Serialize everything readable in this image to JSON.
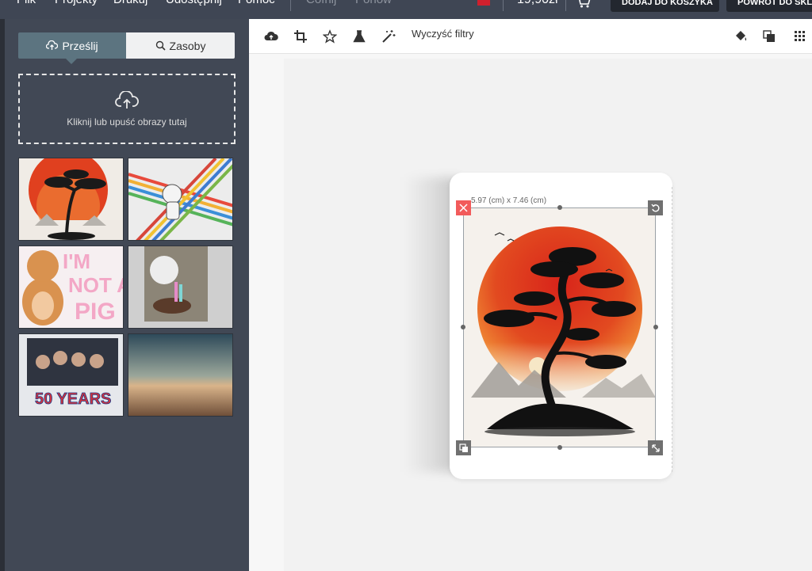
{
  "menu": {
    "items": [
      "Plik",
      "Projekty",
      "Drukuj",
      "Udostępnij",
      "Pomoc"
    ],
    "undo": "Cofnij",
    "redo": "Ponów"
  },
  "header": {
    "price": "19,90zł",
    "add_to_cart": "DODAJ DO KOSZYKA",
    "back_to_shop": "POWRÓT DO SKL"
  },
  "sidebar": {
    "tab_upload": "Prześlij",
    "tab_resources": "Zasoby",
    "dropzone_text": "Kliknij lub upuść obrazy tutaj",
    "thumbnails": [
      {
        "name": "thumb-bonsai-sunset"
      },
      {
        "name": "thumb-astronaut-stripes"
      },
      {
        "name": "thumb-im-not-a-pig",
        "text": "I'M NOT A PIG"
      },
      {
        "name": "thumb-dog-cake"
      },
      {
        "name": "thumb-band-50-years",
        "text": "50 YEARS"
      },
      {
        "name": "thumb-landscape-horizon"
      }
    ]
  },
  "toolbar": {
    "icons": [
      "cloud-upload-icon",
      "crop-icon",
      "star-icon",
      "flask-icon",
      "magic-wand-icon"
    ],
    "clear_filters": "Wyczyść filtry",
    "right_icons": [
      "paint-bucket-icon",
      "layers-icon",
      "grid-icon"
    ]
  },
  "canvas": {
    "dimensions": "5.97 (cm) x 7.46 (cm)"
  },
  "colors": {
    "topbar": "#3f4654",
    "sidebar": "#414855",
    "accent_tab": "#5c7480",
    "delete": "#f25b5b"
  }
}
